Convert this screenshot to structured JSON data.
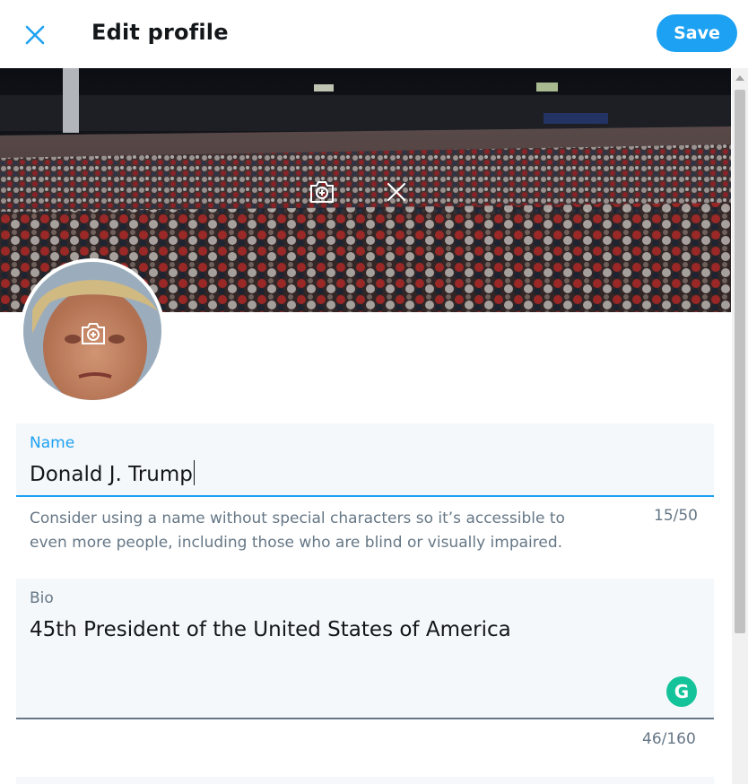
{
  "header": {
    "title": "Edit profile",
    "save_label": "Save",
    "close_icon": "close-icon"
  },
  "banner": {
    "camera_icon": "camera-add-icon",
    "remove_icon": "close-icon"
  },
  "avatar": {
    "camera_icon": "camera-add-icon"
  },
  "name_field": {
    "label": "Name",
    "value": "Donald J. Trump",
    "help_line1": "Consider using a name without special characters so it’s accessible to",
    "help_line2": "even more people, including those who are blind or visually impaired.",
    "count": "15/50"
  },
  "bio_field": {
    "label": "Bio",
    "value": "45th President of the United States of America",
    "count": "46/160",
    "grammarly_letter": "G"
  },
  "colors": {
    "accent": "#1da1f2",
    "text": "#14171a",
    "muted": "#657786",
    "field_bg": "#f5f8fa",
    "grammarly": "#15c39a"
  }
}
